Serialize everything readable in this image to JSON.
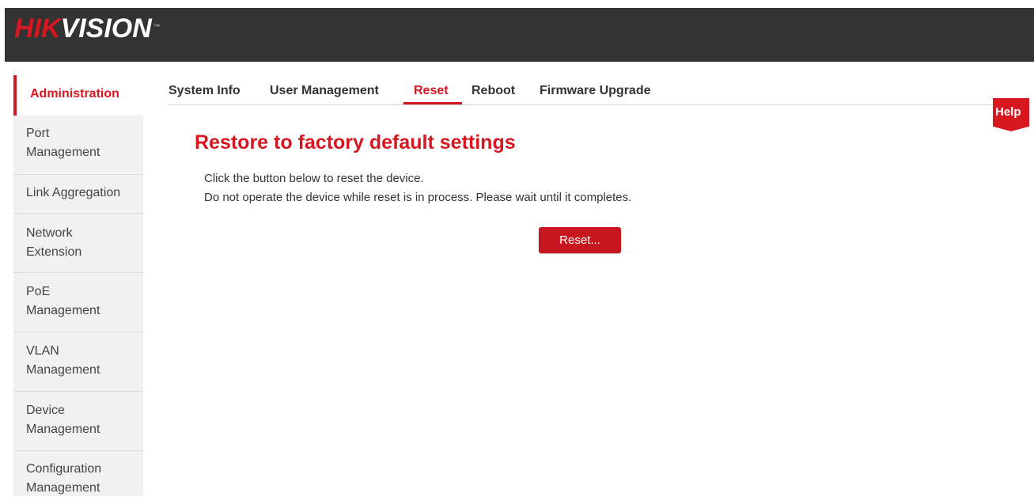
{
  "brand": {
    "logo_part1": "HIK",
    "logo_part2": "VISION",
    "trademark": "™"
  },
  "sidebar": {
    "items": [
      {
        "label_lines": [
          "Administration"
        ],
        "active": true
      },
      {
        "label_lines": [
          "Port",
          "Management"
        ],
        "active": false
      },
      {
        "label_lines": [
          "Link Aggregation"
        ],
        "active": false
      },
      {
        "label_lines": [
          "Network",
          "Extension"
        ],
        "active": false
      },
      {
        "label_lines": [
          "PoE",
          "Management"
        ],
        "active": false
      },
      {
        "label_lines": [
          "VLAN",
          "Management"
        ],
        "active": false
      },
      {
        "label_lines": [
          "Device",
          "Management"
        ],
        "active": false
      },
      {
        "label_lines": [
          "Configuration",
          "Management"
        ],
        "active": false
      }
    ]
  },
  "tabs": [
    {
      "label": "System Info",
      "active": false
    },
    {
      "label": "User Management",
      "active": false
    },
    {
      "label": "Reset",
      "active": true
    },
    {
      "label": "Reboot",
      "active": false
    },
    {
      "label": "Firmware Upgrade",
      "active": false
    }
  ],
  "help": {
    "label": "Help"
  },
  "main": {
    "title": "Restore to factory default settings",
    "line1": "Click the button below to reset the device.",
    "line2": "Do not operate the device while reset is in process. Please wait until it completes.",
    "reset_button": "Reset..."
  },
  "colors": {
    "accent": "#d7171f",
    "header_bg": "#333333",
    "sidebar_bg": "#f1f1f1"
  }
}
